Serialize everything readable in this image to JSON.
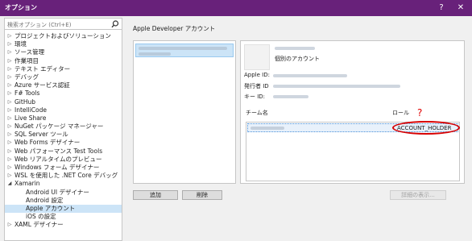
{
  "window": {
    "title": "オプション",
    "help_btn": "?",
    "close_btn": "✕"
  },
  "search": {
    "placeholder": "検索オプション (Ctrl+E)",
    "icon": "search-icon"
  },
  "tree": [
    {
      "label": "プロジェクトおよびソリューション",
      "arrow": "▷"
    },
    {
      "label": "環境",
      "arrow": "▷"
    },
    {
      "label": "ソース管理",
      "arrow": "▷"
    },
    {
      "label": "作業項目",
      "arrow": "▷"
    },
    {
      "label": "テキスト エディター",
      "arrow": "▷"
    },
    {
      "label": "デバッグ",
      "arrow": "▷"
    },
    {
      "label": "Azure サービス認証",
      "arrow": "▷"
    },
    {
      "label": "F# Tools",
      "arrow": "▷"
    },
    {
      "label": "GitHub",
      "arrow": "▷"
    },
    {
      "label": "IntelliCode",
      "arrow": "▷"
    },
    {
      "label": "Live Share",
      "arrow": "▷"
    },
    {
      "label": "NuGet パッケージ マネージャー",
      "arrow": "▷"
    },
    {
      "label": "SQL Server ツール",
      "arrow": "▷"
    },
    {
      "label": "Web Forms デザイナー",
      "arrow": "▷"
    },
    {
      "label": "Web パフォーマンス Test Tools",
      "arrow": "▷"
    },
    {
      "label": "Web リアルタイムのプレビュー",
      "arrow": "▷"
    },
    {
      "label": "Windows フォーム デザイナー",
      "arrow": "▷"
    },
    {
      "label": "WSL を使用した .NET Core デバッグ",
      "arrow": "▷"
    },
    {
      "label": "Xamarin",
      "arrow": "◢"
    },
    {
      "label": "Android UI デザイナー",
      "child": true
    },
    {
      "label": "Android 設定",
      "child": true
    },
    {
      "label": "Apple アカウント",
      "child": true,
      "selected": true
    },
    {
      "label": "iOS の設定",
      "child": true
    },
    {
      "label": "XAML デザイナー",
      "arrow": "▷"
    }
  ],
  "main": {
    "section_title": "Apple Developer アカウント",
    "add_btn": "追加",
    "remove_btn": "削除",
    "details_btn": "詳細の表示...",
    "details": {
      "account_type": "個別のアカウント",
      "apple_id_label": "Apple ID:",
      "issuer_id_label": "発行者 ID",
      "key_id_label": "キー ID:",
      "team_label": "チーム名",
      "role_label": "ロール",
      "role_value": "ACCOUNT_HOLDER",
      "annotation_mark": "?"
    }
  }
}
